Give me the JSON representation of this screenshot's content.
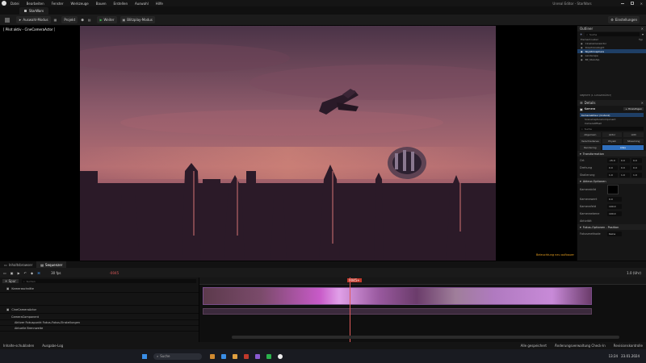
{
  "menu": {
    "items": [
      "Datei",
      "Bearbeiten",
      "Fenster",
      "Werkzeuge",
      "Bauen",
      "Erstellen",
      "Auswahl",
      "Hilfe"
    ],
    "app_title": "Unreal Editor - StarWars"
  },
  "tab": {
    "level_name": "StarWars"
  },
  "toolbar": {
    "mode": "Auswahl-Modus",
    "project": "Projekt",
    "play": "Weiter",
    "simulate": "Blitzplay-Modus",
    "settings": "Einstellungen"
  },
  "viewport": {
    "pilot_label": "[ Pilot aktiv - CineCameraActor ]",
    "warning": "Beleuchtung neu aufbauen"
  },
  "outliner": {
    "title": "Outliner",
    "search_placeholder": "Suche",
    "columns": [
      "Element-Label",
      "Typ"
    ],
    "rows": [
      "CineCameraActor",
      "DirectionalLight",
      "SkyAtmosphere",
      "Landscape",
      "BP_Starship"
    ],
    "footer": "OBJEKTE (1 AUSGEWÄHLT)"
  },
  "details": {
    "title": "Details",
    "actor_name": "Kamera",
    "add_button": "+ Hinzufügen",
    "components": [
      "Kameraakteur (Instanz)",
      "SceneCaptureComponent",
      "CameraOffset"
    ],
    "search_placeholder": "Suche",
    "filters": [
      "Allgemein",
      "Aktor",
      "LOD",
      "Verschiedenes",
      "Physik",
      "Streaming",
      "Rendering",
      "Alles"
    ],
    "active_filter": "Alles",
    "transform_title": "Transformation",
    "transform_rows": [
      {
        "label": "Ort",
        "values": [
          "-15.0",
          "0.0",
          "0.0"
        ]
      },
      {
        "label": "Drehung",
        "values": [
          "0.0",
          "0.0",
          "0.0"
        ]
      },
      {
        "label": "Skalierung",
        "values": [
          "1.0",
          "1.0",
          "1.0"
        ]
      }
    ],
    "actor_options_title": "Akteur-Optionen",
    "props": [
      {
        "label": "Kamerabild",
        "value": ""
      },
      {
        "label": "Kamerawert",
        "value": "0.0"
      },
      {
        "label": "Kamerafeld",
        "value": "100.0"
      },
      {
        "label": "Kameraebene",
        "value": "100.0"
      },
      {
        "label": "Aktivität",
        "value": ""
      }
    ],
    "focus_title": "Fokus-Optionen - Position",
    "focus_row": {
      "label": "Fokusmethode",
      "value": "Keine"
    }
  },
  "sequencer": {
    "tabs": [
      "Inhaltsbrowser",
      "Sequenzer"
    ],
    "active_tab": "Sequenzer",
    "fps": "30 fps",
    "frame_in": "-0045",
    "frame_current": "0045+",
    "frame_out": "1.0 (Uhr)",
    "track_add": "+ Spur",
    "search_placeholder": "Suchen",
    "tracks": [
      "Kameraschnitte",
      "",
      "CineCameraActor",
      "CameraComponent",
      "Aktiver Fokuspunkt Fokus-Fokus-Einstellungen",
      "Aktuelle Brennweite"
    ]
  },
  "statusbar": {
    "items": [
      "Inhalte-schubladen",
      "Ausgabe-Log"
    ],
    "right": [
      "Alle gespeichert",
      "Änderungsverwaltung Check-In",
      "Revisionskontrolle"
    ]
  },
  "taskbar": {
    "search_placeholder": "Suche",
    "time": "13:24",
    "date": "23.01.2024"
  },
  "colors": {
    "accent": "#2f6fbd",
    "selection": "#1f3f66",
    "warning": "#e8a020",
    "clip": "#c85ac8"
  }
}
